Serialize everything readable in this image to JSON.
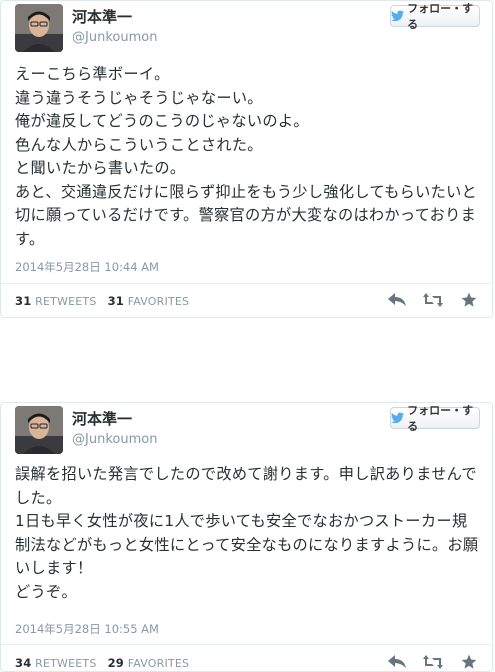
{
  "follow_label": "フォロー・する",
  "tweets": [
    {
      "name": "河本準一",
      "handle": "@Junkoumon",
      "text": "えーこちら準ボーイ。\n違う違うそうじゃそうじゃなーい。\n俺が違反してどうのこうのじゃないのよ。\n色んな人からこういうことされた。\nと聞いたから書いたの。\nあと、交通違反だけに限らず抑止をもう少し強化してもらいたいと切に願っているだけです。警察官の方が大変なのはわかっております。",
      "timestamp": "2014年5月28日  10:44 AM",
      "retweets": "31",
      "retweets_label": "RETWEETS",
      "favorites": "31",
      "favorites_label": "FAVORITES"
    },
    {
      "name": "河本準一",
      "handle": "@Junkoumon",
      "text": "誤解を招いた発言でしたので改めて謝ります。申し訳ありませんでした。\n1日も早く女性が夜に1人で歩いても安全でなおかつストーカー規制法などがもっと女性にとって安全なものになりますように。お願いします！\nどうぞ。",
      "timestamp": "2014年5月28日  10:55 AM",
      "retweets": "34",
      "retweets_label": "RETWEETS",
      "favorites": "29",
      "favorites_label": "FAVORITES"
    }
  ],
  "colors": {
    "bird": "#55acee",
    "muted": "#8899a6",
    "action_icon": "#66757f"
  }
}
